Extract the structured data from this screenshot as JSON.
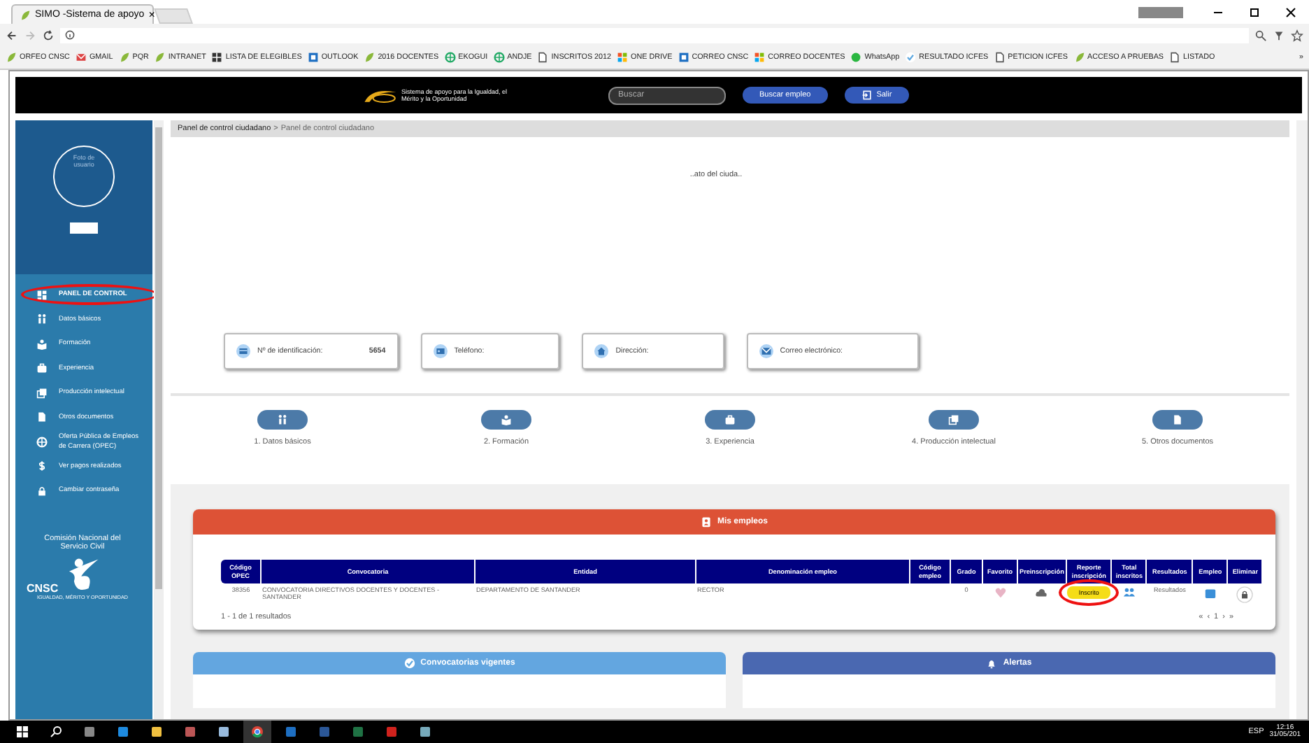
{
  "browser": {
    "tab": {
      "title": "SIMO -Sistema de apoyo",
      "close": "×"
    },
    "bookmarks": [
      "ORFEO CNSC",
      "GMAIL",
      "PQR",
      "INTRANET",
      "LISTA DE ELEGIBLES",
      "OUTLOOK",
      "2016 DOCENTES",
      "EKOGUI",
      "ANDJE",
      "INSCRITOS 2012",
      "ONE DRIVE",
      "CORREO CNSC",
      "CORREO DOCENTES",
      "WhatsApp",
      "RESULTADO ICFES",
      "PETICION ICFES",
      "ACCESO A PRUEBAS",
      "LISTADO"
    ],
    "more": "»"
  },
  "header": {
    "logo_text": "Sistema de apoyo para la Igualdad, el Mérito y la Oportunidad",
    "search": {
      "placeholder": "Buscar"
    },
    "buttons": [
      "Buscar empleo",
      "Salir"
    ]
  },
  "sidebar": {
    "photo_text": "Foto de usuario",
    "items": [
      {
        "label": "PANEL DE CONTROL",
        "selected": true,
        "highlighted": true
      },
      {
        "label": "Datos básicos",
        "selected": false,
        "highlighted": false
      },
      {
        "label": "Formación",
        "selected": false,
        "highlighted": false
      },
      {
        "label": "Experiencia",
        "selected": false,
        "highlighted": false
      },
      {
        "label": "Producción intelectual",
        "selected": false,
        "highlighted": false
      },
      {
        "label": "Otros documentos",
        "selected": false,
        "highlighted": false
      },
      {
        "label": "Oferta Pública de Empleos de Carrera (OPEC)",
        "selected": false,
        "highlighted": false
      },
      {
        "label": "Ver pagos realizados",
        "selected": false,
        "highlighted": false
      },
      {
        "label": "Cambiar contraseña",
        "selected": false,
        "highlighted": false
      }
    ],
    "org_name": "Comisión Nacional del Servicio Civil",
    "org_acronym": "CNSC",
    "org_motto": "IGUALDAD, MÉRITO Y OPORTUNIDAD"
  },
  "breadcrumb": [
    "Panel de control ciudadano",
    "Panel de control ciudadano"
  ],
  "breadcrumb_separator": ">",
  "citizen_heading": "..ato del ciuda..",
  "info_cards": [
    {
      "label": "Nº de identificación:",
      "value": "5654"
    },
    {
      "label": "Teléfono:"
    },
    {
      "label": "Dirección:"
    },
    {
      "label": "Correo electrónico:"
    }
  ],
  "steps": [
    "1. Datos básicos",
    "2. Formación",
    "3. Experiencia",
    "4. Producción intelectual",
    "5. Otros documentos"
  ],
  "my_jobs": {
    "title": "Mis empleos",
    "columns": [
      "Código OPEC",
      "Convocatoria",
      "Entidad",
      "Denominación empleo",
      "Código empleo",
      "Grado",
      "Favorito",
      "Preinscripción",
      "Reporte inscripción",
      "Total inscritos",
      "Resultados",
      "Empleo",
      "Eliminar"
    ],
    "rows": [
      [
        {
          "kind": "text",
          "text": "38356"
        },
        {
          "kind": "text",
          "text": "CONVOCATORIA DIRECTIVOS DOCENTES Y DOCENTES - SANTANDER"
        },
        {
          "kind": "text",
          "text": "DEPARTAMENTO DE SANTANDER"
        },
        {
          "kind": "text",
          "text": "RECTOR"
        },
        {
          "kind": "empty"
        },
        {
          "kind": "text",
          "text": "0"
        },
        {
          "kind": "heart"
        },
        {
          "kind": "cloud"
        },
        {
          "kind": "badge",
          "text": "Inscrito",
          "highlighted": true
        },
        {
          "kind": "people"
        },
        {
          "kind": "text",
          "text": "Resultados"
        },
        {
          "kind": "briefcase"
        },
        {
          "kind": "lock"
        }
      ]
    ],
    "summary": "1 - 1 de 1 resultados",
    "pagination": [
      "«",
      "‹",
      "1",
      "›",
      "»"
    ]
  },
  "panels": [
    "Convocatorias vigentes",
    "Alertas"
  ],
  "taskbar": {
    "language": "ESP",
    "time": "12:16",
    "date": "31/05/201"
  }
}
